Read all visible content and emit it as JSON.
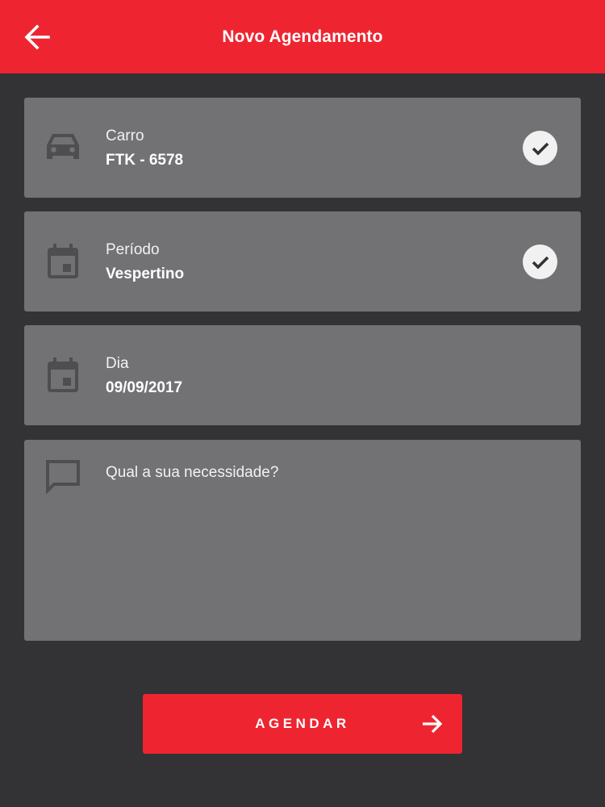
{
  "appbar": {
    "title": "Novo Agendamento",
    "back_icon": "arrow-left-icon",
    "background": "#ee2531"
  },
  "cards": {
    "car": {
      "icon": "car-icon",
      "label": "Carro",
      "value": "FTK - 6578",
      "status_icon": "check-icon"
    },
    "period": {
      "icon": "calendar-icon",
      "label": "Período",
      "value": "Vespertino",
      "status_icon": "check-icon"
    },
    "day": {
      "icon": "calendar-icon",
      "label": "Dia",
      "value": "09/09/2017"
    },
    "need": {
      "icon": "message-icon",
      "placeholder": "Qual a sua necessidade?",
      "value": ""
    }
  },
  "cta": {
    "label": "AGENDAR",
    "icon": "arrow-right-icon",
    "background": "#ee2531"
  },
  "colors": {
    "background": "#333234",
    "card": "#727173",
    "icon": "#4e4d50"
  }
}
